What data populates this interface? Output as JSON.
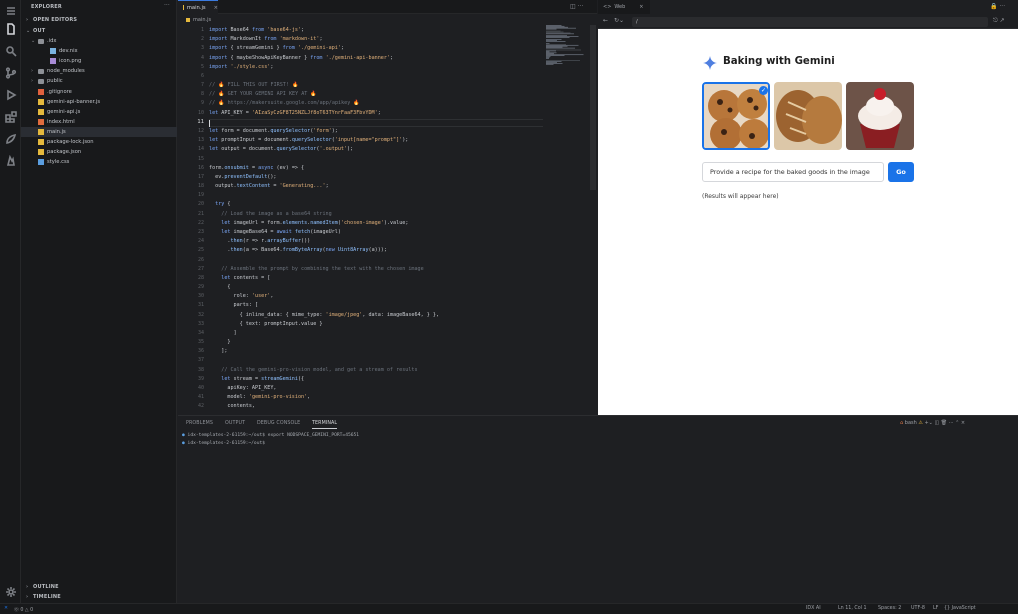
{
  "sidebar": {
    "explorer_title": "EXPLORER",
    "open_editors": "OPEN EDITORS",
    "root": "OUT",
    "tree": [
      {
        "label": ".idx",
        "indent": 1,
        "type": "folder-open"
      },
      {
        "label": "dev.nix",
        "indent": 2,
        "type": "nix"
      },
      {
        "label": "icon.png",
        "indent": 2,
        "type": "img"
      },
      {
        "label": "node_modules",
        "indent": 1,
        "type": "folder"
      },
      {
        "label": "public",
        "indent": 1,
        "type": "folder"
      },
      {
        "label": ".gitignore",
        "indent": 1,
        "type": "git"
      },
      {
        "label": "gemini-api-banner.js",
        "indent": 1,
        "type": "js"
      },
      {
        "label": "gemini-api.js",
        "indent": 1,
        "type": "js"
      },
      {
        "label": "index.html",
        "indent": 1,
        "type": "html"
      },
      {
        "label": "main.js",
        "indent": 1,
        "type": "js"
      },
      {
        "label": "package-lock.json",
        "indent": 1,
        "type": "json"
      },
      {
        "label": "package.json",
        "indent": 1,
        "type": "json"
      },
      {
        "label": "style.css",
        "indent": 1,
        "type": "css"
      }
    ],
    "outline": "OUTLINE",
    "timeline": "TIMELINE"
  },
  "editor": {
    "tab": "main.js",
    "breadcrumb": "main.js",
    "current_line": "11",
    "lines": [
      [
        [
          "kw",
          "import"
        ],
        [
          "pn",
          " Base64 "
        ],
        [
          "kw",
          "from"
        ],
        [
          "st",
          " 'base64-js'"
        ],
        [
          "pn",
          ";"
        ]
      ],
      [
        [
          "kw",
          "import"
        ],
        [
          "pn",
          " MarkdownIt "
        ],
        [
          "kw",
          "from"
        ],
        [
          "st",
          " 'markdown-it'"
        ],
        [
          "pn",
          ";"
        ]
      ],
      [
        [
          "kw",
          "import"
        ],
        [
          "pn",
          " { streamGemini } "
        ],
        [
          "kw",
          "from"
        ],
        [
          "st",
          " './gemini-api'"
        ],
        [
          "pn",
          ";"
        ]
      ],
      [
        [
          "kw",
          "import"
        ],
        [
          "pn",
          " { maybeShowApiKeyBanner } "
        ],
        [
          "kw",
          "from"
        ],
        [
          "st",
          " './gemini-api-banner'"
        ],
        [
          "pn",
          ";"
        ]
      ],
      [
        [
          "kw",
          "import"
        ],
        [
          "st",
          " './style.css'"
        ],
        [
          "pn",
          ";"
        ]
      ],
      [],
      [
        [
          "cm",
          "// 🔥 FILL THIS OUT FIRST! 🔥"
        ]
      ],
      [
        [
          "cm",
          "// 🔥 GET YOUR GEMINI API KEY AT 🔥"
        ]
      ],
      [
        [
          "cm",
          "// 🔥 https://makersuite.google.com/app/apikey 🔥"
        ]
      ],
      [
        [
          "kw",
          "let"
        ],
        [
          "pn",
          " API_KEY = "
        ],
        [
          "st",
          "'AIzaSyCzGF8T25NZLJf8oT63TYnrFaaF3FbvYDM'"
        ],
        [
          "pn",
          ";"
        ]
      ],
      [],
      [
        [
          "kw",
          "let"
        ],
        [
          "pn",
          " form = document."
        ],
        [
          "fn",
          "querySelector"
        ],
        [
          "pn",
          "("
        ],
        [
          "st",
          "'form'"
        ],
        [
          "pn",
          ");"
        ]
      ],
      [
        [
          "kw",
          "let"
        ],
        [
          "pn",
          " promptInput = document."
        ],
        [
          "fn",
          "querySelector"
        ],
        [
          "pn",
          "("
        ],
        [
          "st",
          "'input[name=\"prompt\"]'"
        ],
        [
          "pn",
          ");"
        ]
      ],
      [
        [
          "kw",
          "let"
        ],
        [
          "pn",
          " output = document."
        ],
        [
          "fn",
          "querySelector"
        ],
        [
          "pn",
          "("
        ],
        [
          "st",
          "'.output'"
        ],
        [
          "pn",
          ");"
        ]
      ],
      [],
      [
        [
          "pn",
          "form."
        ],
        [
          "fn",
          "onsubmit"
        ],
        [
          "pn",
          " = "
        ],
        [
          "kw",
          "async"
        ],
        [
          "pn",
          " (ev) => {"
        ]
      ],
      [
        [
          "pn",
          "  ev."
        ],
        [
          "fn",
          "preventDefault"
        ],
        [
          "pn",
          "();"
        ]
      ],
      [
        [
          "pn",
          "  output."
        ],
        [
          "fn",
          "textContent"
        ],
        [
          "pn",
          " = "
        ],
        [
          "st",
          "'Generating...'"
        ],
        [
          "pn",
          ";"
        ]
      ],
      [],
      [
        [
          "kw",
          "  try"
        ],
        [
          "pn",
          " {"
        ]
      ],
      [
        [
          "cm",
          "    // Load the image as a base64 string"
        ]
      ],
      [
        [
          "kw",
          "    let"
        ],
        [
          "pn",
          " imageUrl = form."
        ],
        [
          "fn",
          "elements"
        ],
        [
          "pn",
          "."
        ],
        [
          "fn",
          "namedItem"
        ],
        [
          "pn",
          "("
        ],
        [
          "st",
          "'chosen-image'"
        ],
        [
          "pn",
          ").value;"
        ]
      ],
      [
        [
          "kw",
          "    let"
        ],
        [
          "pn",
          " imageBase64 = "
        ],
        [
          "kw",
          "await"
        ],
        [
          "fn",
          " fetch"
        ],
        [
          "pn",
          "(imageUrl)"
        ]
      ],
      [
        [
          "pn",
          "      ."
        ],
        [
          "fn",
          "then"
        ],
        [
          "pn",
          "(r => r."
        ],
        [
          "fn",
          "arrayBuffer"
        ],
        [
          "pn",
          "())"
        ]
      ],
      [
        [
          "pn",
          "      ."
        ],
        [
          "fn",
          "then"
        ],
        [
          "pn",
          "(a => Base64."
        ],
        [
          "fn",
          "fromByteArray"
        ],
        [
          "pn",
          "("
        ],
        [
          "kw",
          "new"
        ],
        [
          "fn",
          " Uint8Array"
        ],
        [
          "pn",
          "(a)));"
        ]
      ],
      [],
      [
        [
          "cm",
          "    // Assemble the prompt by combining the text with the chosen image"
        ]
      ],
      [
        [
          "kw",
          "    let"
        ],
        [
          "pn",
          " contents = ["
        ]
      ],
      [
        [
          "pn",
          "      {"
        ]
      ],
      [
        [
          "pn",
          "        role: "
        ],
        [
          "st",
          "'user'"
        ],
        [
          "pn",
          ","
        ]
      ],
      [
        [
          "pn",
          "        parts: ["
        ]
      ],
      [
        [
          "pn",
          "          { inline_data: { mime_type: "
        ],
        [
          "st",
          "'image/jpeg'"
        ],
        [
          "pn",
          ", data: imageBase64, } },"
        ]
      ],
      [
        [
          "pn",
          "          { text: promptInput.value }"
        ]
      ],
      [
        [
          "pn",
          "        ]"
        ]
      ],
      [
        [
          "pn",
          "      }"
        ]
      ],
      [
        [
          "pn",
          "    ];"
        ]
      ],
      [],
      [
        [
          "cm",
          "    // Call the gemini-pro-vision model, and get a stream of results"
        ]
      ],
      [
        [
          "kw",
          "    let"
        ],
        [
          "pn",
          " stream = "
        ],
        [
          "fn",
          "streamGemini"
        ],
        [
          "pn",
          "({"
        ]
      ],
      [
        [
          "pn",
          "      apiKey: API_KEY,"
        ]
      ],
      [
        [
          "pn",
          "      model: "
        ],
        [
          "st",
          "'gemini-pro-vision'"
        ],
        [
          "pn",
          ","
        ]
      ],
      [
        [
          "pn",
          "      contents,"
        ]
      ]
    ]
  },
  "preview": {
    "tab": "Web",
    "url": "/",
    "title": "Baking with Gemini",
    "prompt_value": "Provide a recipe for the baked goods in the image",
    "go_label": "Go",
    "results": "(Results will appear here)"
  },
  "panel": {
    "tabs": [
      "PROBLEMS",
      "OUTPUT",
      "DEBUG CONSOLE",
      "TERMINAL"
    ],
    "terminal_name": "bash",
    "terminal_lines": [
      "idx-templates-2-61159:~/out$ export NODSPACE_GEMINI_PORT=45651",
      "idx-templates-2-61159:~/out$ "
    ]
  },
  "status": {
    "left": "⓪ 0 △ 0",
    "items": [
      "IDX AI",
      "Ln 11, Col 1",
      "Spaces: 2",
      "UTF-8",
      "LF",
      "{} JavaScript"
    ]
  },
  "colors": {
    "accent": "#1a73e8",
    "editor_bg": "#1e1f22",
    "sidebar_bg": "#18191b"
  }
}
